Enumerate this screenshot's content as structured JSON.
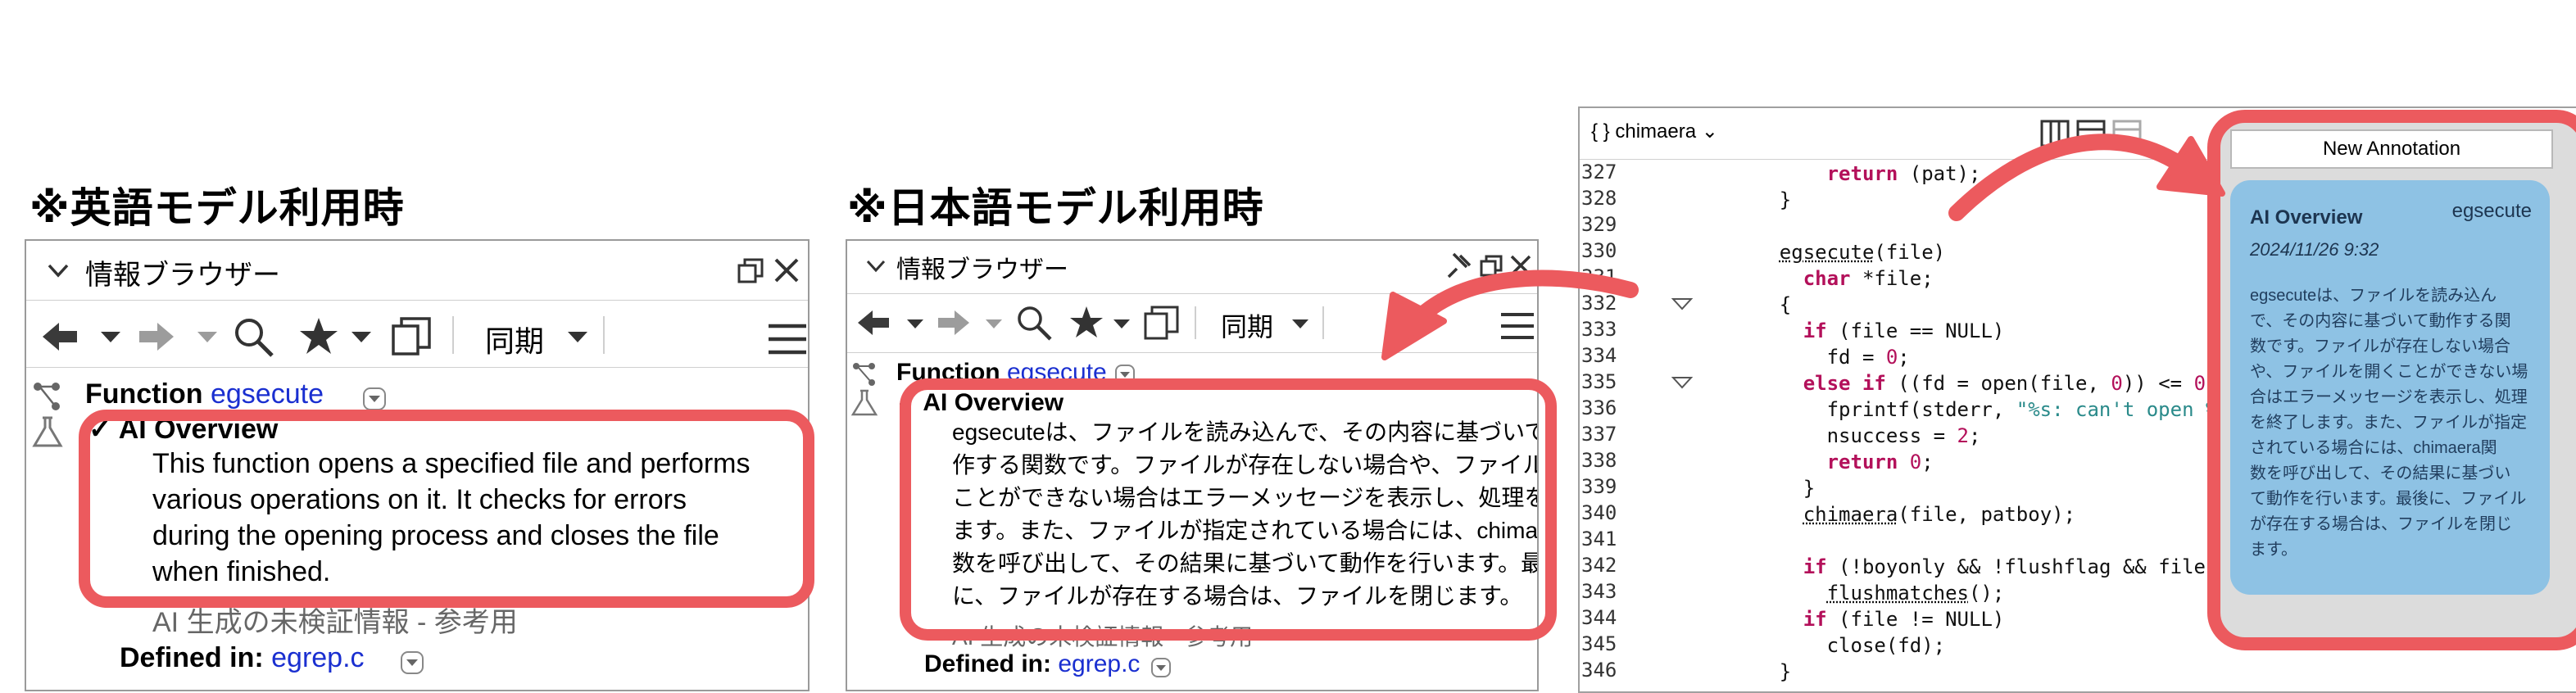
{
  "headings": {
    "english": "※英語モデル利用時",
    "japanese": "※日本語モデル利用時"
  },
  "left_panel": {
    "title": "情報ブラウザー",
    "sync_label": "同期",
    "function_label": "Function",
    "function_name": "egsecute",
    "ai_overview_label": "AI Overview",
    "overview_lines": [
      "This function opens a specified file and performs",
      "various operations on it. It checks for errors",
      "during the opening process and closes the file",
      "when finished."
    ],
    "disclaimer": "AI 生成の未検証情報 - 参考用",
    "defined_in_label": "Defined in:",
    "defined_in_file": "egrep.c"
  },
  "middle_panel": {
    "title": "情報ブラウザー",
    "sync_label": "同期",
    "function_label": "Function",
    "function_name": "egsecute",
    "ai_overview_label": "AI Overview",
    "overview_lines": [
      "egsecuteは、ファイルを読み込んで、その内容に基づいて動",
      "作する関数です。ファイルが存在しない場合や、ファイルを開く",
      "ことができない場合はエラーメッセージを表示し、処理を終了し",
      "ます。また、ファイルが指定されている場合には、chimaera関",
      "数を呼び出して、その結果に基づいて動作を行います。最後",
      "に、ファイルが存在する場合は、ファイルを閉じます。"
    ],
    "disclaimer": "AI 生成の未検証情報 - 参考用",
    "defined_in_label": "Defined in:",
    "defined_in_file": "egrep.c"
  },
  "code_panel": {
    "scope_label": "{ } chimaera",
    "line_numbers": [
      "327",
      "328",
      "329",
      "330",
      "331",
      "332",
      "333",
      "334",
      "335",
      "336",
      "337",
      "338",
      "339",
      "340",
      "341",
      "342",
      "343",
      "344",
      "345",
      "346"
    ]
  },
  "annotation_panel": {
    "new_annotation_label": "New Annotation",
    "card_title": "AI Overview",
    "card_tag": "egsecute",
    "card_date": "2024/11/26 9:32",
    "card_lines": [
      "egsecuteは、ファイルを読み込ん",
      "で、その内容に基づいて動作する関",
      "数です。ファイルが存在しない場合",
      "や、ファイルを開くことができない場",
      "合はエラーメッセージを表示し、処理",
      "を終了します。また、ファイルが指定",
      "されている場合には、chimaera関",
      "数を呼び出して、その結果に基づい",
      "て動作を行います。最後に、ファイル",
      "が存在する場合は、ファイルを閉じ",
      "ます。"
    ]
  },
  "colors": {
    "highlight": "#ec5a5e",
    "link": "#1a2fd0",
    "card": "#8ec2e4"
  }
}
